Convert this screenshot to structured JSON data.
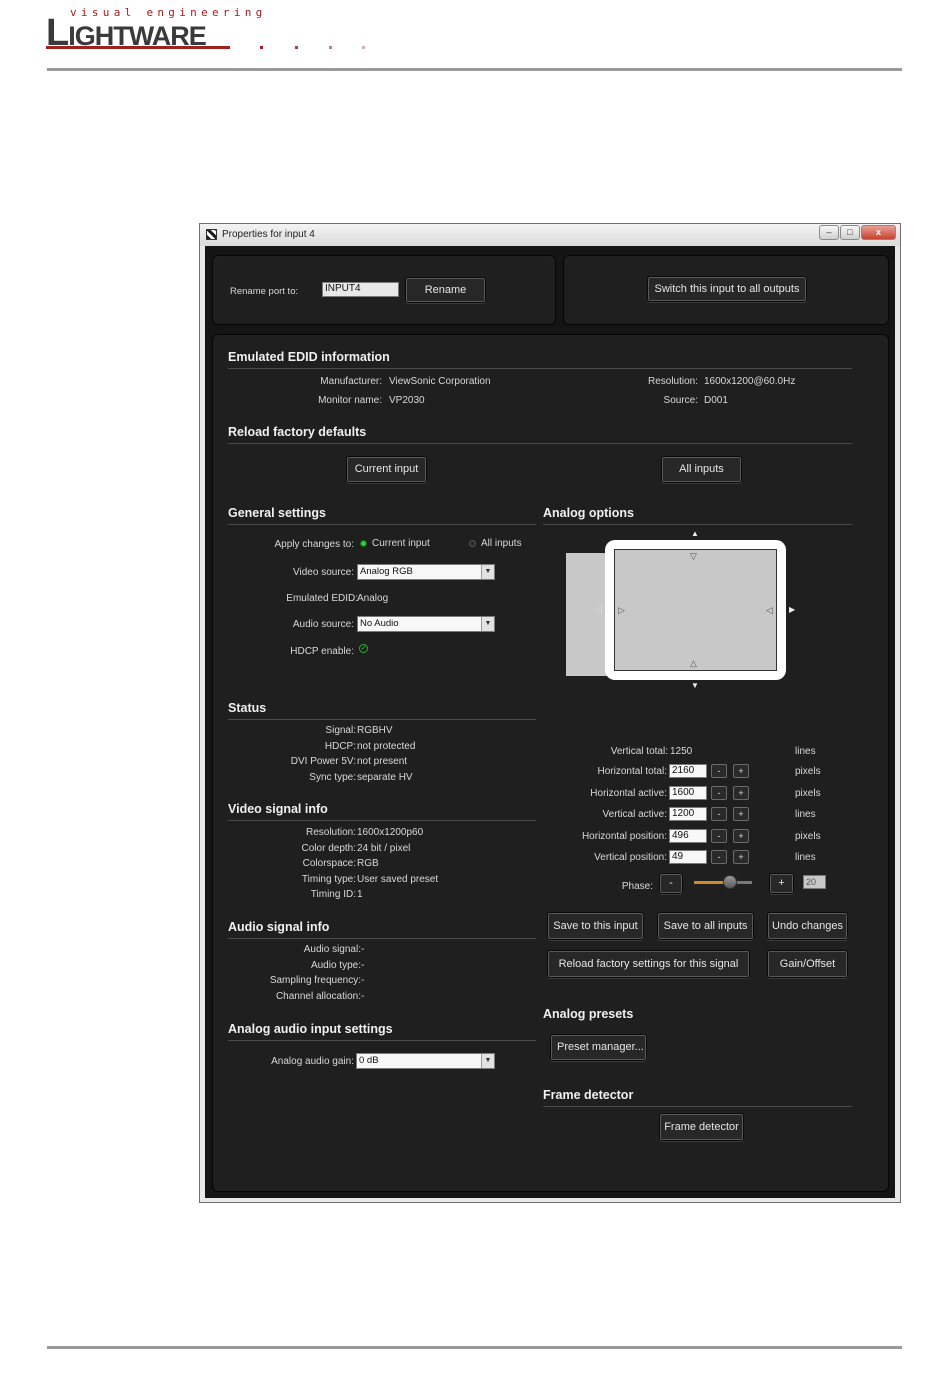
{
  "header": {
    "logo_tagline": "visual engineering",
    "logo_name_first": "L",
    "logo_name_rest": "IGHTWARE",
    "dot_colors": [
      "#a02020",
      "#b04040",
      "#c58080",
      "#d8b0b0"
    ]
  },
  "window": {
    "title": "Properties for input 4",
    "controls": {
      "minimize": "–",
      "maximize": "□",
      "close": "x"
    }
  },
  "rename": {
    "label": "Rename port to:",
    "value": "INPUT4",
    "button": "Rename"
  },
  "switch_all_button": "Switch this input to all outputs",
  "edid": {
    "heading": "Emulated EDID information",
    "manufacturer_label": "Manufacturer:",
    "manufacturer_value": "ViewSonic Corporation",
    "monitor_label": "Monitor name:",
    "monitor_value": "VP2030",
    "resolution_label": "Resolution:",
    "resolution_value": "1600x1200@60.0Hz",
    "source_label": "Source:",
    "source_value": "D001"
  },
  "reload": {
    "heading": "Reload factory defaults",
    "current_button": "Current input",
    "all_button": "All inputs"
  },
  "general": {
    "heading": "General settings",
    "apply_label": "Apply changes to:",
    "apply_option_current": "Current input",
    "apply_option_all": "All inputs",
    "video_source_label": "Video source:",
    "video_source_value": "Analog RGB",
    "emulated_edid_label": "Emulated EDID:",
    "emulated_edid_value": "Analog",
    "audio_source_label": "Audio source:",
    "audio_source_value": "No Audio",
    "hdcp_label": "HDCP enable:"
  },
  "status": {
    "heading": "Status",
    "rows": [
      {
        "label": "Signal:",
        "value": "RGBHV"
      },
      {
        "label": "HDCP:",
        "value": "not protected"
      },
      {
        "label": "DVI Power 5V:",
        "value": "not present"
      },
      {
        "label": "Sync type:",
        "value": "separate HV"
      }
    ]
  },
  "video_info": {
    "heading": "Video signal info",
    "rows": [
      {
        "label": "Resolution:",
        "value": "1600x1200p60"
      },
      {
        "label": "Color depth:",
        "value": "24 bit / pixel"
      },
      {
        "label": "Colorspace:",
        "value": "RGB"
      },
      {
        "label": "Timing type:",
        "value": "User saved preset"
      },
      {
        "label": "Timing ID:",
        "value": "1"
      }
    ]
  },
  "audio_info": {
    "heading": "Audio signal info",
    "rows": [
      {
        "label": "Audio signal:",
        "value": "-"
      },
      {
        "label": "Audio type:",
        "value": "-"
      },
      {
        "label": "Sampling frequency:",
        "value": "-"
      },
      {
        "label": "Channel allocation:",
        "value": "-"
      }
    ]
  },
  "analog_audio": {
    "heading": "Analog audio input settings",
    "gain_label": "Analog audio gain:",
    "gain_value": "0 dB"
  },
  "analog_options": {
    "heading": "Analog options",
    "vertical_total_label": "Vertical total:",
    "vertical_total_value": "1250",
    "vertical_total_unit": "lines",
    "rows": [
      {
        "label": "Horizontal total:",
        "value": "2160",
        "unit": "pixels"
      },
      {
        "label": "Horizontal active:",
        "value": "1600",
        "unit": "pixels"
      },
      {
        "label": "Vertical active:",
        "value": "1200",
        "unit": "lines"
      },
      {
        "label": "Horizontal position:",
        "value": "496",
        "unit": "pixels"
      },
      {
        "label": "Vertical position:",
        "value": "49",
        "unit": "lines"
      }
    ],
    "minus": "-",
    "plus": "+",
    "phase_label": "Phase:",
    "phase_value": "20",
    "phase_fraction": 0.62,
    "save_this_button": "Save to this input",
    "save_all_button": "Save to all inputs",
    "undo_button": "Undo changes",
    "reload_factory_button": "Reload factory settings for this signal",
    "gain_offset_button": "Gain/Offset"
  },
  "presets": {
    "heading": "Analog presets",
    "button": "Preset manager..."
  },
  "frame_detector": {
    "heading": "Frame detector",
    "button": "Frame detector"
  },
  "colors": {
    "brand_red": "#a02020",
    "radio_active": "#33cc33",
    "panel_bg": "#1f1f1f"
  }
}
